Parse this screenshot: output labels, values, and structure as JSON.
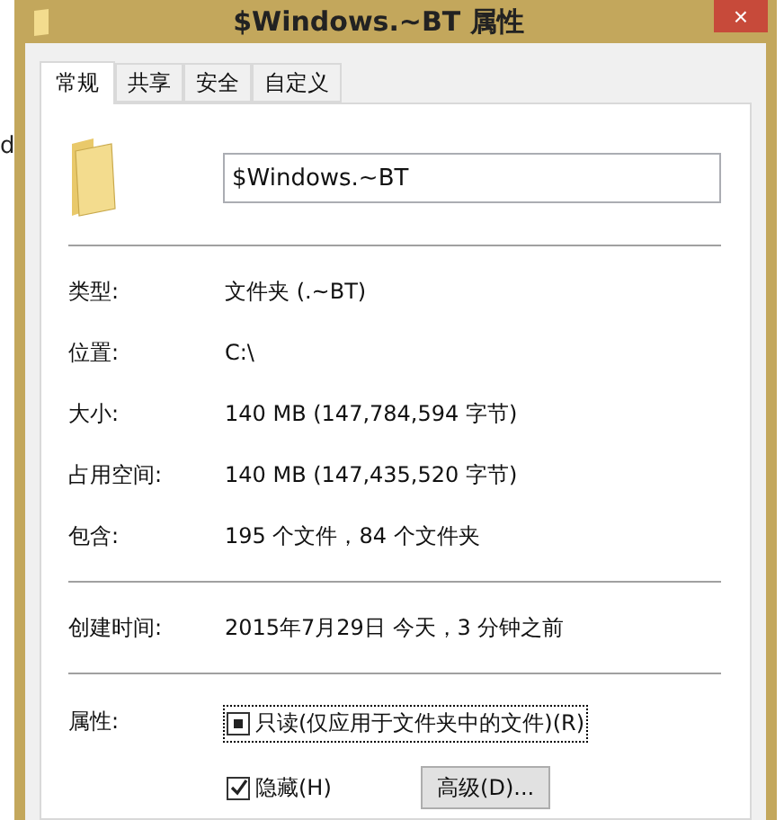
{
  "background": {
    "text": "d"
  },
  "window": {
    "title": "$Windows.~BT 属性",
    "close": "×"
  },
  "tabs": [
    {
      "label": "常规",
      "selected": true
    },
    {
      "label": "共享",
      "selected": false
    },
    {
      "label": "安全",
      "selected": false
    },
    {
      "label": "自定义",
      "selected": false
    }
  ],
  "name_field": {
    "value": "$Windows.~BT"
  },
  "info_groups": [
    [
      {
        "label": "类型:",
        "value": "文件夹 (.~BT)"
      },
      {
        "label": "位置:",
        "value": "C:\\"
      },
      {
        "label": "大小:",
        "value": "140 MB (147,784,594 字节)"
      },
      {
        "label": "占用空间:",
        "value": "140 MB (147,435,520 字节)"
      },
      {
        "label": "包含:",
        "value": "195 个文件，84 个文件夹"
      }
    ],
    [
      {
        "label": "创建时间:",
        "value": "2015年7月29日 今天，3 分钟之前"
      }
    ]
  ],
  "attributes": {
    "label": "属性:",
    "options": [
      {
        "label": "只读(仅应用于文件夹中的文件)(R)",
        "checked": false,
        "partial": true,
        "focused": true
      },
      {
        "label": "隐藏(H)",
        "checked": true,
        "partial": false,
        "focused": false
      }
    ],
    "advanced_button": "高级(D)..."
  }
}
